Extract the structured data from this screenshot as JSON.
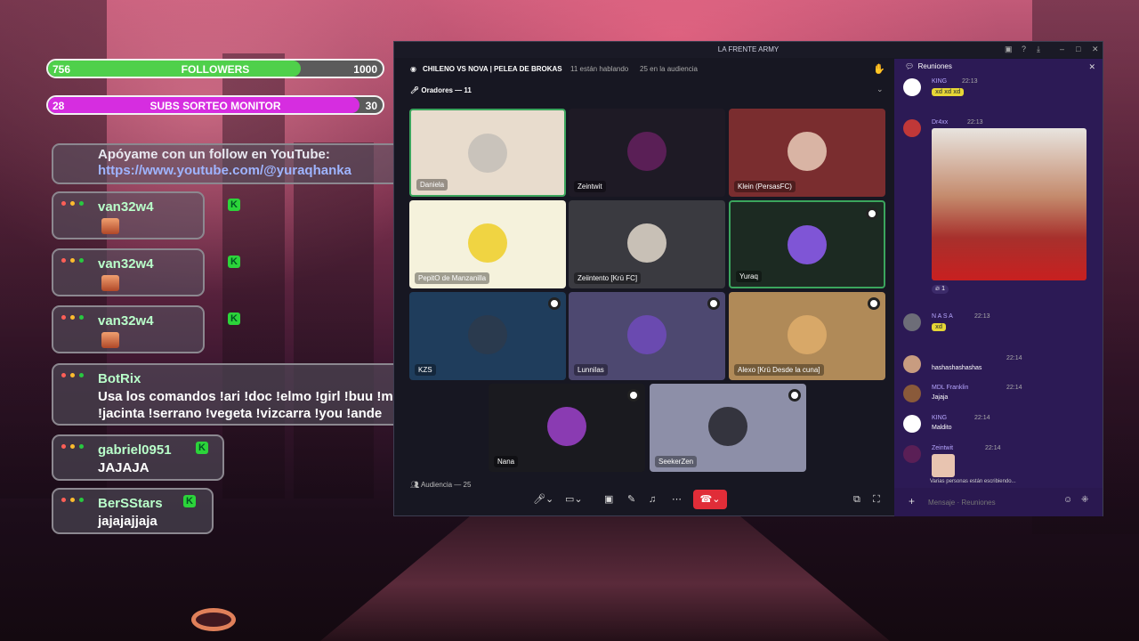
{
  "goals": {
    "followers": {
      "current": "756",
      "label": "FOLLOWERS",
      "target": "1000",
      "fraction": 0.756,
      "color": "#4fd04b"
    },
    "subs": {
      "current": "28",
      "label": "SUBS SORTEO MONITOR",
      "target": "30",
      "fraction": 0.93,
      "color": "#d62de0"
    }
  },
  "chat": {
    "promo": {
      "line1": "Apóyame con un follow en YouTube:",
      "line2": "https://www.youtube.com/@yuraqhanka"
    },
    "messages": [
      {
        "user": "van32w4",
        "text": ""
      },
      {
        "user": "van32w4",
        "text": ""
      },
      {
        "user": "van32w4",
        "text": ""
      },
      {
        "user": "BotRix",
        "text1": "Usa los comandos !ari !doc !elmo !girl !buu !mickey",
        "text2": "!jacinta !serrano !vegeta !vizcarra !you !ande"
      },
      {
        "user": "gabriel0951",
        "text": "JAJAJA"
      },
      {
        "user": "BerSStars",
        "text": "jajajajjaja"
      }
    ]
  },
  "discord": {
    "window_title": "LA FRENTE ARMY",
    "stage_title": "CHILENO VS NOVA | PELEA DE BROKAS",
    "speaking": "11 están hablando",
    "audience_count": "25 en la audiencia",
    "speakers_header": "Oradores — 11",
    "audience_header": "Audiencia — 25",
    "tiles": [
      {
        "name": "Daniela",
        "bg": "#e8dccd",
        "avatar": "#c9c3bb"
      },
      {
        "name": "Zeintwit",
        "bg": "#1e1a25",
        "avatar": "#5a1f56"
      },
      {
        "name": "Klein (PersasFC)",
        "bg": "#7a2d2f",
        "avatar": "#d9b4a4"
      },
      {
        "name": "PepitO de Manzanilla",
        "bg": "#f5f2dc",
        "avatar": "#f0d442"
      },
      {
        "name": "Zeiintento [Krū FC]",
        "bg": "#3a3a40",
        "avatar": "#c8c0b6"
      },
      {
        "name": "Yuraq",
        "bg": "#1c2a22",
        "avatar": "#7f55d6"
      },
      {
        "name": "KZS",
        "bg": "#1f3d5c",
        "avatar": "#2a3a4e"
      },
      {
        "name": "Lunnilas",
        "bg": "#4d4870",
        "avatar": "#6a4ab0"
      },
      {
        "name": "Alexo [Krū Desde la cuna]",
        "bg": "#b08a58",
        "avatar": "#d8a868"
      },
      {
        "name": "Nana",
        "bg": "#1a1a1f",
        "avatar": "#8a3bb2"
      },
      {
        "name": "SeekerZen",
        "bg": "#8d8fa8",
        "avatar": "#34343e"
      }
    ],
    "panel": {
      "title": "Reuniones",
      "composer_placeholder": "Mensaje · Reuniones",
      "typing": "Varias personas están escribiendo...",
      "messages": [
        {
          "user": "KING",
          "time": "22:13",
          "text": "xd xd xd"
        },
        {
          "user": "Dr4xx",
          "time": "22:13",
          "text": ""
        },
        {
          "user": "N A S A",
          "time": "22:13",
          "text": "xd"
        },
        {
          "user": "",
          "time": "22:14",
          "text": "hashashashashas"
        },
        {
          "user": "MDL Franklin",
          "time": "22:14",
          "text": "Jajaja"
        },
        {
          "user": "KING",
          "time": "22:14",
          "text": "Maldito"
        },
        {
          "user": "Zeintwit",
          "time": "22:14",
          "text": ""
        }
      ],
      "reaction_count": "1"
    }
  }
}
